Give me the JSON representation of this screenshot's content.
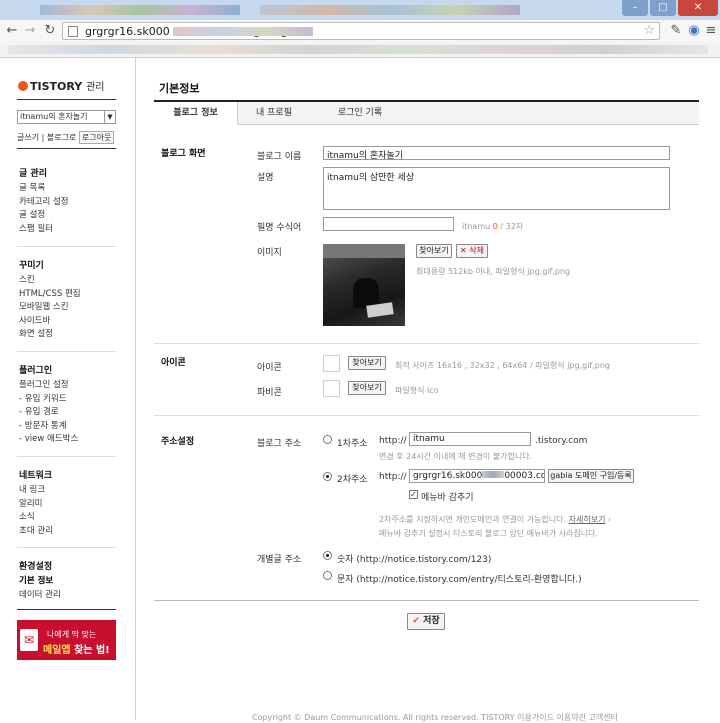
{
  "browser": {
    "url": "grgrgr16.sk000          n/admin/setting/blog/",
    "back_icon": "back-arrow-icon",
    "forward_icon": "forward-arrow-icon",
    "reload_icon": "reload-icon",
    "star_icon": "star-icon",
    "window_controls": [
      "–",
      "□",
      "✕"
    ]
  },
  "sidebar": {
    "brand": "TISTORY",
    "brand_sub": "관리",
    "blog_select": "itnamu의 혼자놀기",
    "links": {
      "write": "글쓰기",
      "to_blog": "블로그로",
      "logout": "로그아웃"
    },
    "groups": [
      {
        "title": "글 관리",
        "items": [
          "글 목록",
          "카테고리 설정",
          "글 설정",
          "스팸 필터"
        ]
      },
      {
        "title": "꾸미기",
        "items": [
          "스킨",
          "HTML/CSS 편집",
          "모바일웹 스킨",
          "사이드바",
          "화면 설정"
        ]
      },
      {
        "title": "플러그인",
        "items": [
          "플러그인 설정",
          "- 유입 키워드",
          "- 유입 경로",
          "- 방문자 통계",
          "- view 애드박스"
        ]
      },
      {
        "title": "네트워크",
        "items": [
          "내 링크",
          "알리미",
          "소식",
          "초대 관리"
        ]
      },
      {
        "title": "환경설정",
        "items": [
          "기본 정보",
          "데이터 관리"
        ],
        "active": "기본 정보"
      }
    ],
    "banner": {
      "line1": "나에게 딱 맞는",
      "line2a": "메일앱",
      "line2b": "찾는 법!"
    }
  },
  "main": {
    "title": "기본정보",
    "tabs": [
      "블로그 정보",
      "내 프로필",
      "로그인 기록"
    ],
    "blog_screen": {
      "section": "블로그 화면",
      "name_label": "블로그 이름",
      "name_value": "itnamu의 혼자놀기",
      "desc_label": "설명",
      "desc_value": "itnamu의 삼만한 세상",
      "nick_label": "필명 수식어",
      "nick_hint_name": "itnamu",
      "nick_count": "0",
      "nick_max": " / 32자",
      "image_label": "이미지",
      "find_button": "찾아보기",
      "delete_button": "✕ 삭제",
      "image_hint": "최대용량 512kb 이내, 파일형식 jpg,gif,png"
    },
    "icon": {
      "section": "아이콘",
      "icon_label": "아이콘",
      "icon_button": "찾아보기",
      "icon_hint": "최적 사이즈 16x16 , 32x32 , 64x64 / 파일형식 jpg,gif,png",
      "favicon_label": "파비콘",
      "favicon_button": "찾아보기",
      "favicon_hint": "파일형식 ico"
    },
    "address": {
      "section": "주소설정",
      "blog_addr_label": "블로그 주소",
      "primary_label": "1차주소",
      "http1": "http://",
      "primary_value": "itnamu",
      "tistory_domain": ".tistory.com",
      "primary_note": "변경 후 24시간 이내에 재 변경이 불가합니다.",
      "secondary_label": "2차주소",
      "http2": "http://",
      "secondary_value": "grgrgr16.sk000",
      "secondary_value2": "00003.com",
      "gabia_button": "gabia 도메인 구입/등록",
      "menubar_hide": "메뉴바 감추기",
      "note_line1a": "2차주소를 지정하시면 개인도메인과 연결이 가능합니다.",
      "note_more": "자세히보기",
      "note_line2": "메뉴바 감추기 설정시 티스토리 블로그 상단 메뉴바가 사라집니다.",
      "permalink_label": "개별글 주소",
      "permalink_num": "숫자 (http://notice.tistory.com/123)",
      "permalink_text": "문자 (http://notice.tistory.com/entry/티스토리-환영합니다.)"
    },
    "save_button": "저장",
    "footer": "Copyright © Daum Communications. All rights reserved. TISTORY  이용가이드   이용약관   고객센터"
  }
}
